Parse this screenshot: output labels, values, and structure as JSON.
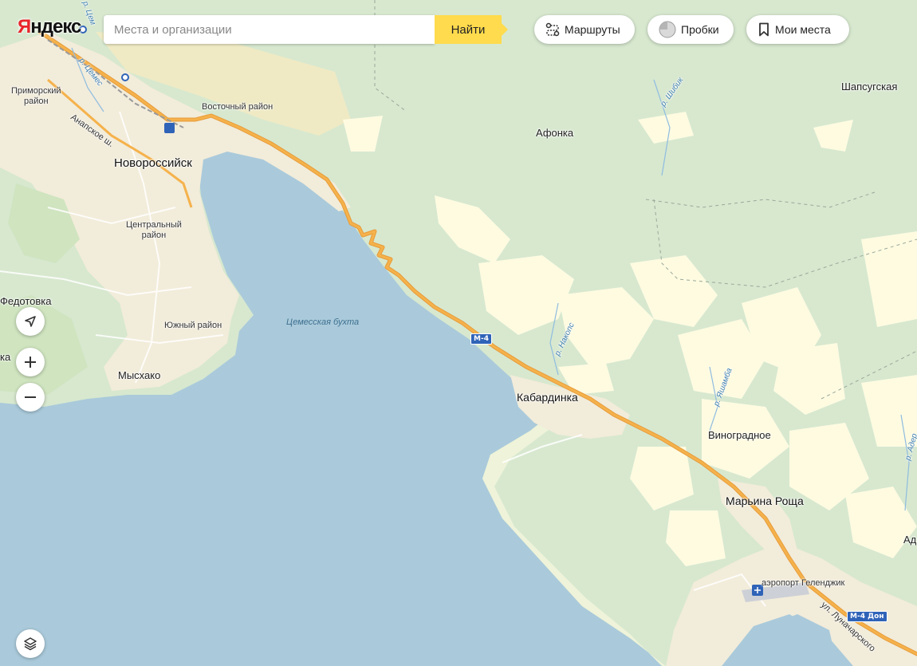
{
  "brand": {
    "logo_first": "Я",
    "logo_rest": "ндекс"
  },
  "search": {
    "placeholder": "Места и организации",
    "value": "",
    "button_label": "Найти"
  },
  "toolbar": {
    "routes_label": "Маршруты",
    "traffic_label": "Пробки",
    "my_places_label": "Мои места"
  },
  "map_labels": {
    "novorossiysk": "Новороссийск",
    "primorsky_line1": "Приморский",
    "primorsky_line2": "район",
    "vostochny": "Восточный район",
    "centralny_line1": "Центральный",
    "centralny_line2": "район",
    "yuzhny": "Южный район",
    "fedotovka": "Федотовка",
    "fedotovka_partial": "ка",
    "myskhako": "Мысхако",
    "tsemesskaya_bay": "Цемесская бухта",
    "afonka": "Афонка",
    "shapsugskaya": "Шапсугская",
    "kabardinka": "Кабардинка",
    "vinogradnoe": "Виноградное",
    "maryina_roscha": "Марьина Роща",
    "airport": "аэропорт Геленджик",
    "ad_partial": "Ад",
    "river_tsemes": "р. Цемес",
    "river_tsem_top": "р. Цем",
    "river_shibik": "р. Шибик",
    "river_nakops": "р. Накопс",
    "river_yashamba": "р. Яшамба",
    "river_adder_partial": "р. Адер",
    "anapskoe_road": "Анапское ш.",
    "lunacharskogo": "ул. Луначарского",
    "route_m4": "М-4",
    "route_m4_don": "М-4 Дон"
  },
  "colors": {
    "sea": "#aacadb",
    "forest": "#d7e8cf",
    "clearing": "#fefbe1",
    "urban": "#f2ecda",
    "highway": "#f5b24b",
    "accent": "#ffdb4d"
  }
}
